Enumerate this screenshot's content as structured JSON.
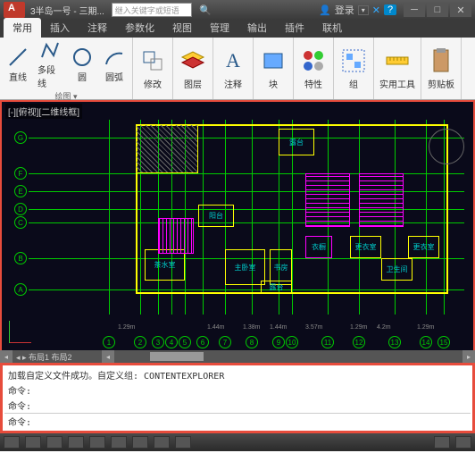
{
  "title": "3半岛一号 - 三期...",
  "search_placeholder": "继入关键字或短语",
  "login_text": "登录",
  "ribbon_tabs": [
    "常用",
    "插入",
    "注释",
    "参数化",
    "视图",
    "管理",
    "输出",
    "插件",
    "联机"
  ],
  "ribbon": {
    "draw_group": "绘图 ▾",
    "line": "直线",
    "polyline": "多段线",
    "circle": "圆",
    "arc": "圆弧",
    "modify": "修改",
    "layer": "图层",
    "annotate": "注释",
    "block": "块",
    "properties": "特性",
    "group": "组",
    "utilities": "实用工具",
    "clipboard": "剪贴板"
  },
  "drawing_tab": "[-][俯视][二维线框]",
  "axis_rows": [
    "G",
    "F",
    "E",
    "D",
    "C",
    "B",
    "A"
  ],
  "axis_cols": [
    "1",
    "2",
    "3",
    "4",
    "5",
    "6",
    "7",
    "8",
    "9",
    "10",
    "11",
    "12",
    "13",
    "14",
    "15"
  ],
  "rooms": {
    "r1": "露台",
    "r2": "阳台",
    "r3": "茶水室",
    "r4": "主卧室",
    "r5": "书房",
    "r6": "露台",
    "r7": "更衣室",
    "r8": "更衣室",
    "r9": "卫生间",
    "r10": "衣橱"
  },
  "dims": [
    "1.29m",
    "1.44m",
    "1.38m",
    "1.44m",
    "3.57m",
    "1.29m",
    "4.2m",
    "1.29m"
  ],
  "cmd": {
    "line1": "加载自定义文件成功。自定义组: CONTENTEXPLORER",
    "line2": "命令:",
    "line3": "命令:",
    "line4": "命令:"
  },
  "status_left": "◂ ▸ 布局1 布局2"
}
